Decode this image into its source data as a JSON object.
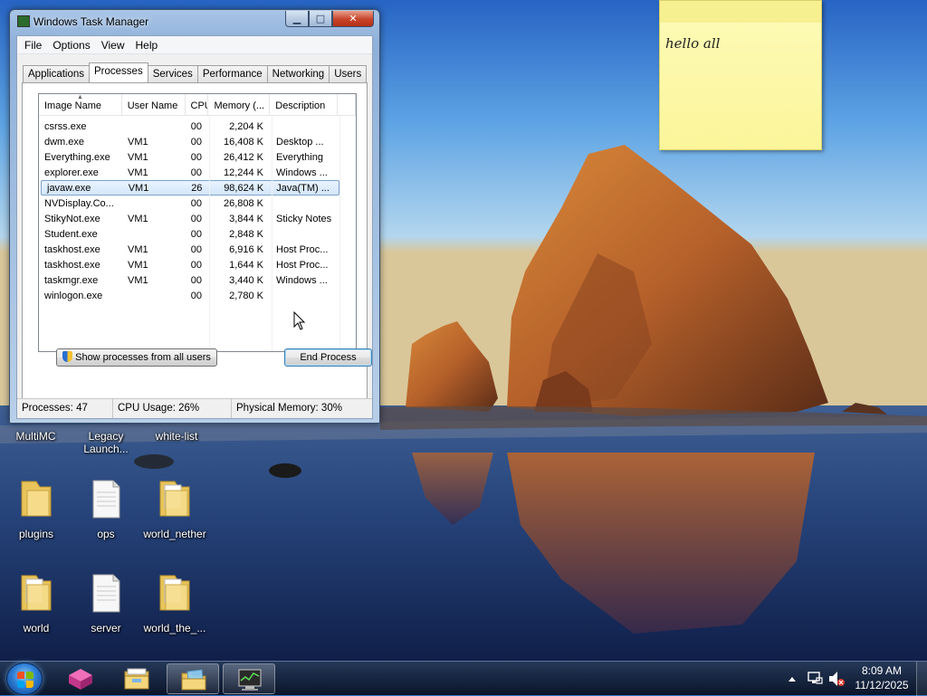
{
  "window": {
    "title": "Windows Task Manager",
    "caption_buttons": {
      "minimize": "▁",
      "maximize": "□",
      "close": "✕"
    },
    "menu": [
      "File",
      "Options",
      "View",
      "Help"
    ],
    "tabs": [
      "Applications",
      "Processes",
      "Services",
      "Performance",
      "Networking",
      "Users"
    ],
    "active_tab": "Processes",
    "columns": [
      "Image Name",
      "User Name",
      "CPU",
      "Memory (...",
      "Description"
    ],
    "processes": [
      {
        "name": "csrss.exe",
        "user": "",
        "cpu": "00",
        "mem": "2,204 K",
        "desc": ""
      },
      {
        "name": "dwm.exe",
        "user": "VM1",
        "cpu": "00",
        "mem": "16,408 K",
        "desc": "Desktop ..."
      },
      {
        "name": "Everything.exe",
        "user": "VM1",
        "cpu": "00",
        "mem": "26,412 K",
        "desc": "Everything"
      },
      {
        "name": "explorer.exe",
        "user": "VM1",
        "cpu": "00",
        "mem": "12,244 K",
        "desc": "Windows ..."
      },
      {
        "name": "javaw.exe",
        "user": "VM1",
        "cpu": "26",
        "mem": "98,624 K",
        "desc": "Java(TM) ..."
      },
      {
        "name": "NVDisplay.Co...",
        "user": "",
        "cpu": "00",
        "mem": "26,808 K",
        "desc": ""
      },
      {
        "name": "StikyNot.exe",
        "user": "VM1",
        "cpu": "00",
        "mem": "3,844 K",
        "desc": "Sticky Notes"
      },
      {
        "name": "Student.exe",
        "user": "",
        "cpu": "00",
        "mem": "2,848 K",
        "desc": ""
      },
      {
        "name": "taskhost.exe",
        "user": "VM1",
        "cpu": "00",
        "mem": "6,916 K",
        "desc": "Host Proc..."
      },
      {
        "name": "taskhost.exe",
        "user": "VM1",
        "cpu": "00",
        "mem": "1,644 K",
        "desc": "Host Proc..."
      },
      {
        "name": "taskmgr.exe",
        "user": "VM1",
        "cpu": "00",
        "mem": "3,440 K",
        "desc": "Windows ..."
      },
      {
        "name": "winlogon.exe",
        "user": "",
        "cpu": "00",
        "mem": "2,780 K",
        "desc": ""
      }
    ],
    "selected_process_index": 4,
    "show_all_label": "Show processes from all users",
    "end_process_label": "End Process",
    "status": {
      "processes": "Processes: 47",
      "cpu": "CPU Usage: 26%",
      "memory": "Physical Memory: 30%"
    }
  },
  "sticky_note": {
    "text": "hello all"
  },
  "desktop": {
    "top_labels": [
      "MultiMC",
      "Legacy Launch...",
      "white-list"
    ],
    "icons": [
      {
        "label": "plugins",
        "type": "folder-icon"
      },
      {
        "label": "ops",
        "type": "file-icon"
      },
      {
        "label": "world_nether",
        "type": "folder-icon"
      },
      {
        "label": "world",
        "type": "folder-icon"
      },
      {
        "label": "server",
        "type": "file-icon"
      },
      {
        "label": "world_the_...",
        "type": "folder-icon"
      }
    ]
  },
  "taskbar": {
    "pinned": [
      "cube-app-icon",
      "file-explorer-icon",
      "folder-window-icon",
      "task-manager-icon"
    ],
    "clock_time": "8:09 AM",
    "clock_date": "11/12/2025",
    "tray_icons": [
      "show-hidden-icons-arrow",
      "network-icon",
      "volume-muted-icon"
    ]
  },
  "colors": {
    "accent": "#3399ff",
    "selection_border": "#7da2ce",
    "sticky_yellow": "#fbf59a",
    "close_red": "#c7432a"
  }
}
